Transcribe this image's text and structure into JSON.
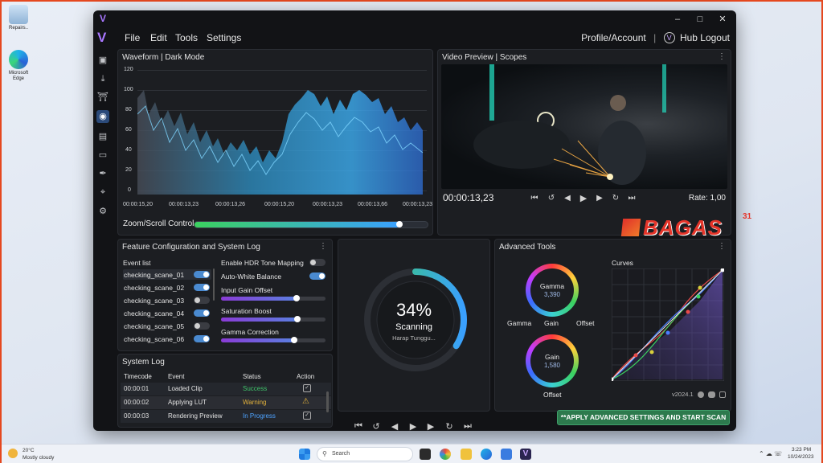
{
  "desktop": {
    "icons": [
      {
        "label": "Repairs.."
      },
      {
        "label": "Microsoft Edge"
      }
    ]
  },
  "window": {
    "menu": [
      "File",
      "Edit",
      "Tools",
      "Settings"
    ],
    "account_label": "Profile/Account",
    "separator": "|",
    "hub_logout": "Hub Logout",
    "logo_letter": "V"
  },
  "sidebar": {
    "icons": [
      "image-icon",
      "download-icon",
      "shield-icon",
      "camera-icon",
      "document-icon",
      "folder-icon",
      "brush-icon",
      "crop-icon",
      "gear-icon"
    ],
    "active_index": 3
  },
  "waveform": {
    "title": "Waveform | Dark Mode",
    "y_ticks": [
      "120",
      "100",
      "80",
      "60",
      "40",
      "20",
      "0"
    ],
    "x_ticks": [
      "00:00:15,20",
      "00:00:13,23",
      "00:00:13,26",
      "00:00:15,20",
      "00:00:13,23",
      "00:00:13,66",
      "00:00:13,23"
    ],
    "zoom_label": "Zoom/Scroll Control",
    "zoom_level": 0.88
  },
  "video": {
    "title": "Video Preview | Scopes",
    "timecode": "00:00:13,23",
    "rate": "Rate: 1,00"
  },
  "features": {
    "title": "Feature Configuration and System Log",
    "event_list_label": "Event list",
    "events": [
      {
        "name": "checking_scane_01",
        "on": true
      },
      {
        "name": "checking_scane_02",
        "on": true
      },
      {
        "name": "checking_scane_03",
        "on": false
      },
      {
        "name": "checking_scane_04",
        "on": true
      },
      {
        "name": "checking_scane_05",
        "on": false
      },
      {
        "name": "checking_scane_06",
        "on": true
      }
    ],
    "settings": {
      "hdr": {
        "label": "Enable HDR Tone Mapping",
        "on": false
      },
      "awb": {
        "label": "Auto-White Balance",
        "on": true
      },
      "gain_offset": {
        "label": "Input Gain Offset",
        "value": 0.72
      },
      "saturation": {
        "label": "Saturation Boost",
        "value": 0.73
      },
      "gamma": {
        "label": "Gamma Correction",
        "value": 0.7
      }
    }
  },
  "log": {
    "title": "System Log",
    "columns": [
      "Timecode",
      "Event",
      "Status",
      "Action"
    ],
    "rows": [
      {
        "time": "00:00:01",
        "event": "Loaded Clip",
        "status": "Success",
        "status_color": "#3fc46a"
      },
      {
        "time": "00:00:02",
        "event": "Applying LUT",
        "status": "Warning",
        "status_color": "#e3b23c"
      },
      {
        "time": "00:00:03",
        "event": "Rendering Preview",
        "status": "In Progress",
        "status_color": "#4ea3ff"
      }
    ]
  },
  "scan": {
    "percent_text": "34%",
    "progress": 0.34,
    "status": "Scanning",
    "subtext": "Harap Tunggu..."
  },
  "advanced": {
    "title": "Advanced Tools",
    "wheel1": {
      "label": "Gamma",
      "value": "3,390"
    },
    "wheel2": {
      "label": "Gain",
      "value": "1,580"
    },
    "labels": {
      "left": "Gamma",
      "mid": "Gain",
      "right": "Offset",
      "bottom": "Offset"
    },
    "curves_label": "Curves",
    "version": "v2024.1"
  },
  "apply_button": "**APPLY ADVANCED SETTINGS AND START SCAN",
  "taskbar": {
    "weather_temp": "20°C",
    "weather_desc": "Mostly cloudy",
    "search_placeholder": "Search",
    "time": "3:23 PM",
    "date": "10/24/2023"
  },
  "watermark": {
    "text": "BAGAS",
    "sup": "31"
  }
}
